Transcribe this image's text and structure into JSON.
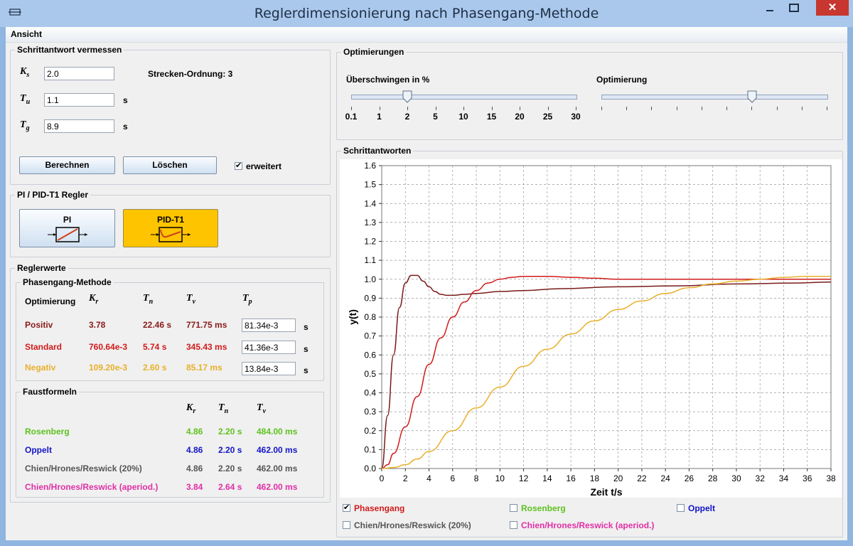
{
  "window": {
    "title": "Reglerdimensionierung nach Phasengang-Methode",
    "close_label": "✕"
  },
  "menu": {
    "items": [
      "Ansicht"
    ]
  },
  "measure": {
    "legend": "Schrittantwort vermessen",
    "ks_symbol": "K",
    "ks_sub": "s",
    "ks_value": "2.0",
    "tu_symbol": "T",
    "tu_sub": "u",
    "tu_value": "1.1",
    "tu_unit": "s",
    "tg_symbol": "T",
    "tg_sub": "g",
    "tg_value": "8.9",
    "tg_unit": "s",
    "order_label": "Strecken-Ordnung: 3",
    "calc_button": "Berechnen",
    "clear_button": "Löschen",
    "extended_label": "erweitert",
    "extended_checked": true
  },
  "controller": {
    "legend": "PI / PID-T1 Regler",
    "pi_label": "PI",
    "pidt1_label": "PID-T1",
    "active": "PID-T1",
    "active_color": "#ffc400"
  },
  "values": {
    "legend": "Reglerwerte",
    "phase": {
      "legend": "Phasengang-Methode",
      "opt_header": "Optimierung",
      "headers": [
        {
          "s": "K",
          "sub": "r"
        },
        {
          "s": "T",
          "sub": "n"
        },
        {
          "s": "T",
          "sub": "v"
        },
        {
          "s": "T",
          "sub": "p"
        }
      ],
      "rows": [
        {
          "name": "Positiv",
          "kr": "3.78",
          "tn": "22.46 s",
          "tv": "771.75 ms",
          "tp": "81.34e-3",
          "unit": "s",
          "color": "#8b1a1a"
        },
        {
          "name": "Standard",
          "kr": "760.64e-3",
          "tn": "5.74 s",
          "tv": "345.43 ms",
          "tp": "41.36e-3",
          "unit": "s",
          "color": "#d11b1b"
        },
        {
          "name": "Negativ",
          "kr": "109.20e-3",
          "tn": "2.60 s",
          "tv": "85.17 ms",
          "tp": "13.84e-3",
          "unit": "s",
          "color": "#e8b02a"
        }
      ]
    },
    "rules": {
      "legend": "Faustformeln",
      "headers": [
        {
          "s": "K",
          "sub": "r"
        },
        {
          "s": "T",
          "sub": "n"
        },
        {
          "s": "T",
          "sub": "v"
        }
      ],
      "rows": [
        {
          "name": "Rosenberg",
          "kr": "4.86",
          "tn": "2.20 s",
          "tv": "484.00 ms",
          "color": "#5ec21f"
        },
        {
          "name": "Oppelt",
          "kr": "4.86",
          "tn": "2.20 s",
          "tv": "462.00 ms",
          "color": "#1414c8"
        },
        {
          "name": "Chien/Hrones/Reswick (20%)",
          "kr": "4.86",
          "tn": "2.20 s",
          "tv": "462.00 ms",
          "color": "#555555"
        },
        {
          "name": "Chien/Hrones/Reswick (aperiod.)",
          "kr": "3.84",
          "tn": "2.64 s",
          "tv": "462.00 ms",
          "color": "#e02fa5"
        }
      ]
    }
  },
  "optimize": {
    "legend": "Optimierungen",
    "overshoot_label": "Überschwingen in %",
    "overshoot_ticks": [
      "0.1",
      "1",
      "2",
      "5",
      "10",
      "15",
      "20",
      "25",
      "30"
    ],
    "overshoot_index": 2,
    "opt_label": "Optimierung",
    "opt_value_fraction": 0.67
  },
  "response": {
    "legend": "Schrittantworten",
    "checks": [
      {
        "label": "Phasengang",
        "checked": true,
        "color": "#d11b1b"
      },
      {
        "label": "Rosenberg",
        "checked": false,
        "color": "#5ec21f"
      },
      {
        "label": "Oppelt",
        "checked": false,
        "color": "#1414c8"
      },
      {
        "label": "Chien/Hrones/Reswick (20%)",
        "checked": false,
        "color": "#555555"
      },
      {
        "label": "Chien/Hrones/Reswick (aperiod.)",
        "checked": false,
        "color": "#e02fa5"
      }
    ]
  },
  "chart_data": {
    "type": "line",
    "xlabel": "Zeit t/s",
    "ylabel": "y(t)",
    "xlim": [
      0,
      38
    ],
    "ylim": [
      0,
      1.6
    ],
    "xticks": [
      0,
      2,
      4,
      6,
      8,
      10,
      12,
      14,
      16,
      18,
      20,
      22,
      24,
      26,
      28,
      30,
      32,
      34,
      36,
      38
    ],
    "yticks": [
      "0.0",
      "0.1",
      "0.2",
      "0.3",
      "0.4",
      "0.5",
      "0.6",
      "0.7",
      "0.8",
      "0.9",
      "1.0",
      "1.1",
      "1.2",
      "1.3",
      "1.4",
      "1.5",
      "1.6"
    ],
    "grid": true,
    "series": [
      {
        "color": "#7a1a1a",
        "x": [
          0,
          0.5,
          1,
          1.5,
          2,
          2.5,
          3,
          3.5,
          4,
          4.5,
          5,
          5.5,
          6,
          7,
          8,
          10,
          12,
          15,
          20,
          25,
          30,
          35,
          38
        ],
        "y": [
          0,
          0.28,
          0.6,
          0.85,
          0.98,
          1.02,
          1.02,
          0.99,
          0.96,
          0.935,
          0.92,
          0.915,
          0.915,
          0.92,
          0.925,
          0.935,
          0.94,
          0.95,
          0.96,
          0.965,
          0.975,
          0.98,
          0.985
        ]
      },
      {
        "color": "#d11b1b",
        "x": [
          0,
          0.5,
          1,
          2,
          3,
          4,
          5,
          6,
          7,
          8,
          9,
          10,
          11,
          12,
          14,
          16,
          18,
          20,
          25,
          30,
          35,
          38
        ],
        "y": [
          0,
          0.02,
          0.08,
          0.22,
          0.38,
          0.55,
          0.69,
          0.8,
          0.88,
          0.94,
          0.98,
          1.0,
          1.01,
          1.015,
          1.015,
          1.01,
          1.005,
          1.0,
          1.0,
          1.0,
          1.0,
          1.0
        ]
      },
      {
        "color": "#e8b02a",
        "x": [
          0,
          1,
          2,
          3,
          4,
          6,
          8,
          10,
          12,
          14,
          16,
          18,
          20,
          22,
          24,
          26,
          28,
          30,
          32,
          34,
          36,
          38
        ],
        "y": [
          0,
          0.005,
          0.02,
          0.05,
          0.09,
          0.2,
          0.32,
          0.43,
          0.54,
          0.63,
          0.71,
          0.78,
          0.84,
          0.885,
          0.925,
          0.955,
          0.975,
          0.99,
          1.0,
          1.01,
          1.015,
          1.015
        ]
      }
    ]
  }
}
